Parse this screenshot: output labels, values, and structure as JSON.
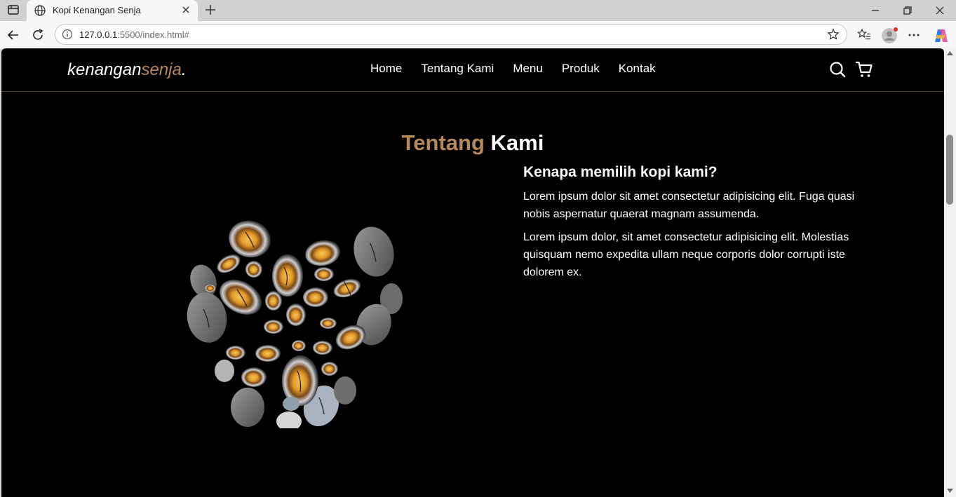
{
  "browser": {
    "tab_title": "Kopi Kenangan Senja",
    "url_host": "127.0.0.1",
    "url_rest": ":5500/index.html#"
  },
  "site": {
    "logo_main": "kenangan",
    "logo_accent": "senja",
    "logo_dot": ".",
    "nav": [
      "Home",
      "Tentang Kami",
      "Menu",
      "Produk",
      "Kontak"
    ],
    "accent_color": "#b6895b"
  },
  "about": {
    "title_accent": "Tentang",
    "title_rest": "Kami",
    "heading": "Kenapa memilih kopi kami?",
    "paragraphs": [
      "Lorem ipsum dolor sit amet consectetur adipisicing elit. Fuga quasi nobis aspernatur quaerat magnam assumenda.",
      "Lorem ipsum dolor, sit amet consectetur adipisicing elit. Molestias quisquam nemo expedita ullam neque corporis dolor corrupti iste dolorem ex."
    ]
  },
  "icons": {
    "browser": [
      "tab-actions-icon",
      "globe-icon",
      "close-icon",
      "new-tab-icon",
      "minimize-icon",
      "restore-icon",
      "window-close-icon",
      "back-icon",
      "reload-icon",
      "info-icon",
      "star-icon",
      "favorites-icon",
      "profile-icon",
      "more-icon",
      "copilot-icon"
    ],
    "site": [
      "search-icon",
      "cart-icon"
    ]
  }
}
